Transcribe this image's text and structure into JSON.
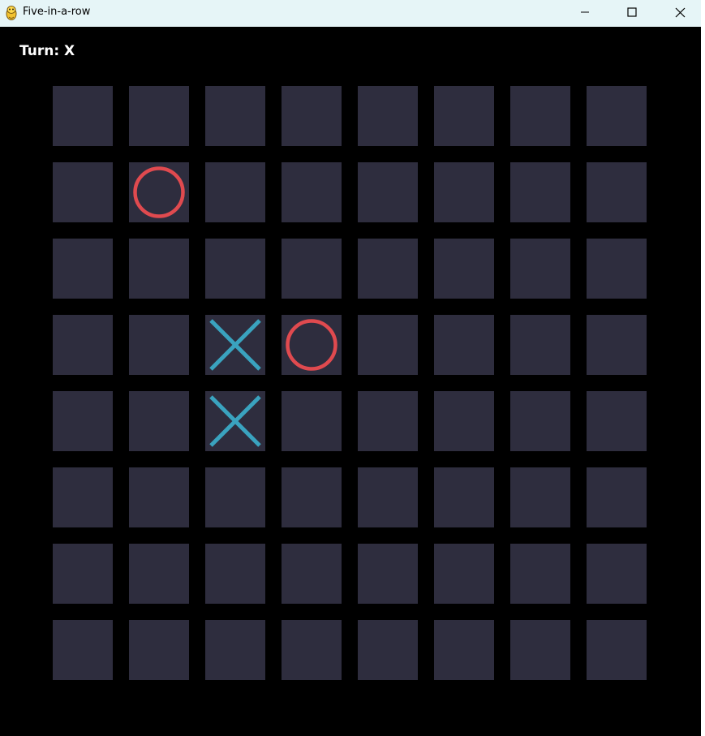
{
  "window": {
    "title": "Five-in-a-row",
    "icon": "pygame-snake-icon"
  },
  "controls": {
    "minimize": "minimize-icon",
    "maximize": "maximize-icon",
    "close": "close-icon"
  },
  "status": {
    "turn_label": "Turn:",
    "turn_value": "X"
  },
  "colors": {
    "background": "#000000",
    "cell": "#2e2d3e",
    "x_mark": "#3aa3bf",
    "o_mark": "#e04a4f"
  },
  "board": {
    "rows": 8,
    "cols": 8,
    "cells": [
      [
        "",
        "",
        "",
        "",
        "",
        "",
        "",
        ""
      ],
      [
        "",
        "O",
        "",
        "",
        "",
        "",
        "",
        ""
      ],
      [
        "",
        "",
        "",
        "",
        "",
        "",
        "",
        ""
      ],
      [
        "",
        "",
        "X",
        "O",
        "",
        "",
        "",
        ""
      ],
      [
        "",
        "",
        "X",
        "",
        "",
        "",
        "",
        ""
      ],
      [
        "",
        "",
        "",
        "",
        "",
        "",
        "",
        ""
      ],
      [
        "",
        "",
        "",
        "",
        "",
        "",
        "",
        ""
      ],
      [
        "",
        "",
        "",
        "",
        "",
        "",
        "",
        ""
      ]
    ]
  }
}
